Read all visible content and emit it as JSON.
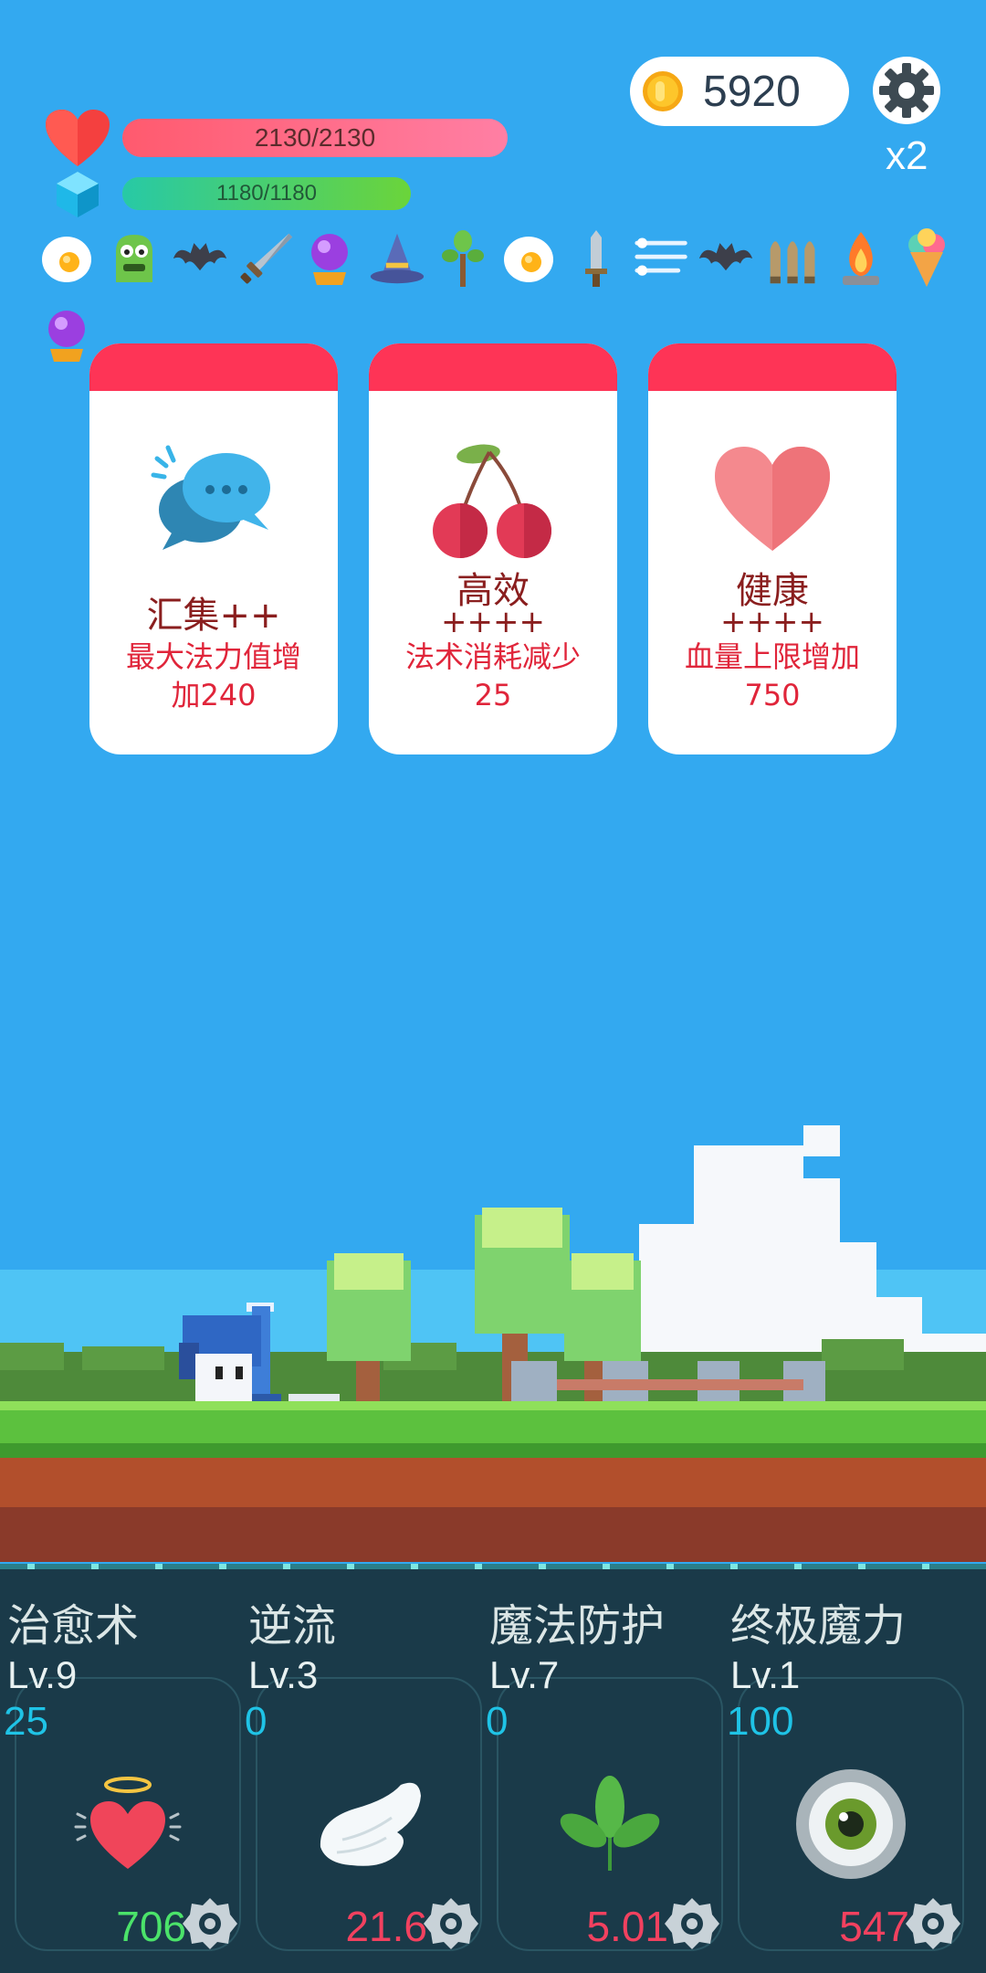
{
  "hud": {
    "coins": "5920",
    "multiplier": "x2",
    "hp_text": "2130/2130",
    "hp_fraction": 1.0,
    "mp_text": "1180/1180",
    "mp_fraction": 1.0,
    "colors": {
      "hp": "#ff5a6e",
      "mp": "#4bd47e",
      "coin": "#fdc62b"
    }
  },
  "items": [
    {
      "name": "fried-egg-icon"
    },
    {
      "name": "green-monster-icon"
    },
    {
      "name": "bat-icon"
    },
    {
      "name": "sword-icon"
    },
    {
      "name": "crystal-ball-icon"
    },
    {
      "name": "wizard-hat-icon"
    },
    {
      "name": "sapling-icon"
    },
    {
      "name": "fried-egg-icon"
    },
    {
      "name": "dagger-icon"
    },
    {
      "name": "wind-lines-icon"
    },
    {
      "name": "bat-icon"
    },
    {
      "name": "bullets-icon"
    },
    {
      "name": "campfire-icon"
    },
    {
      "name": "ice-cream-icon"
    },
    {
      "name": "crystal-ball-icon"
    }
  ],
  "cards": [
    {
      "title": "汇集++",
      "plus": "",
      "desc1": "最大法力值增",
      "desc2": "加240",
      "icon": "speech-bubbles-icon"
    },
    {
      "title": "高效",
      "plus": "++++",
      "desc1": "法术消耗减少",
      "desc2": "25",
      "icon": "cherry-icon"
    },
    {
      "title": "健康",
      "plus": "++++",
      "desc1": "血量上限增加",
      "desc2": "750",
      "icon": "heart-icon"
    }
  ],
  "skills": [
    {
      "name": "治愈术",
      "level": "Lv.9",
      "cost": "25",
      "value": "706",
      "value_color": "#4be36a",
      "icon": "angel-heart-icon"
    },
    {
      "name": "逆流",
      "level": "Lv.3",
      "cost": "0",
      "value": "21.6",
      "value_color": "#f2415f",
      "icon": "wing-icon"
    },
    {
      "name": "魔法防护",
      "level": "Lv.7",
      "cost": "0",
      "value": "5.01",
      "value_color": "#f2415f",
      "icon": "leaf-icon"
    },
    {
      "name": "终极魔力",
      "level": "Lv.1",
      "cost": "100",
      "value": "547",
      "value_color": "#f2415f",
      "icon": "eye-icon"
    }
  ]
}
